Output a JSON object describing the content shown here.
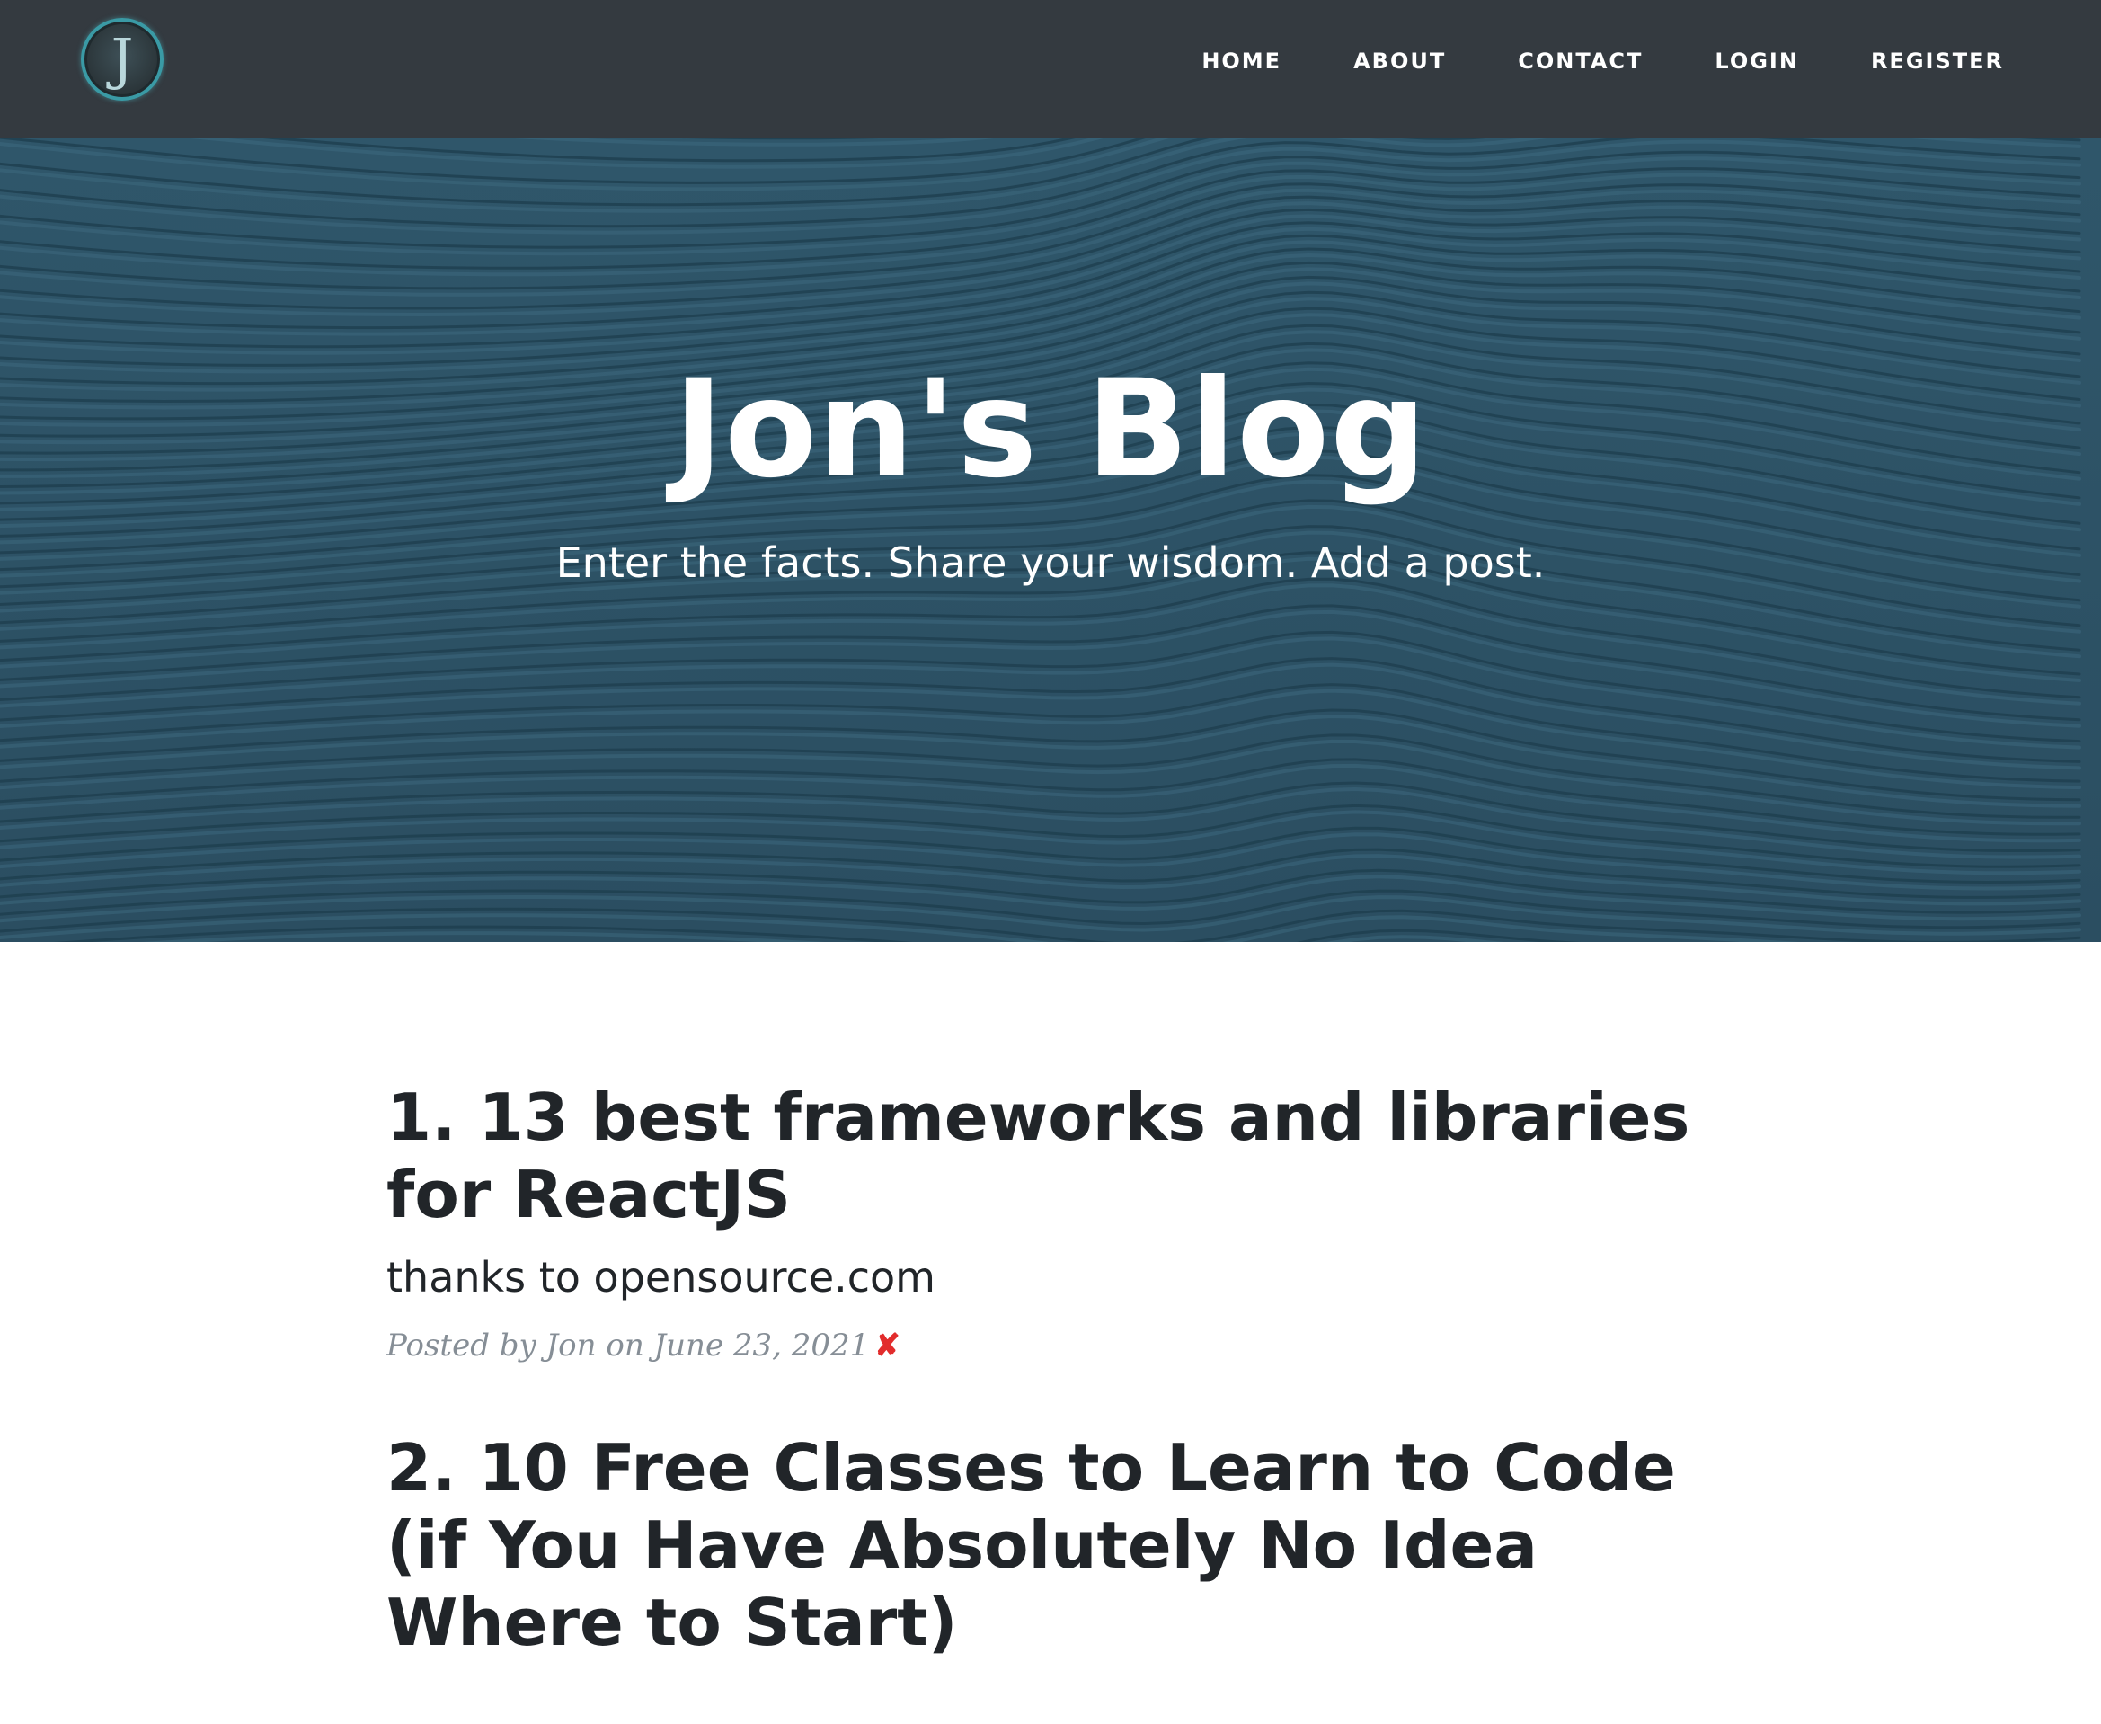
{
  "navbar": {
    "logo_letter": "J",
    "links": [
      {
        "label": "HOME"
      },
      {
        "label": "ABOUT"
      },
      {
        "label": "CONTACT"
      },
      {
        "label": "LOGIN"
      },
      {
        "label": "REGISTER"
      }
    ]
  },
  "hero": {
    "title": "Jon's Blog",
    "subtitle": "Enter the facts. Share your wisdom. Add a post.",
    "background_color": "#2e5468"
  },
  "posts": [
    {
      "title": "1. 13 best frameworks and libraries for ReactJS",
      "subtitle": "thanks to opensource.com",
      "meta": "Posted by Jon on June 23, 2021",
      "delete_icon": "✘"
    },
    {
      "title": "2. 10 Free Classes to Learn to Code (if You Have Absolutely No Idea Where to Start)"
    }
  ],
  "colors": {
    "navbar": "#343a40",
    "accent_logo": "#3a9aa5",
    "text_dark": "#212529",
    "meta_gray": "#868e96",
    "delete_red": "#e22c2c"
  }
}
